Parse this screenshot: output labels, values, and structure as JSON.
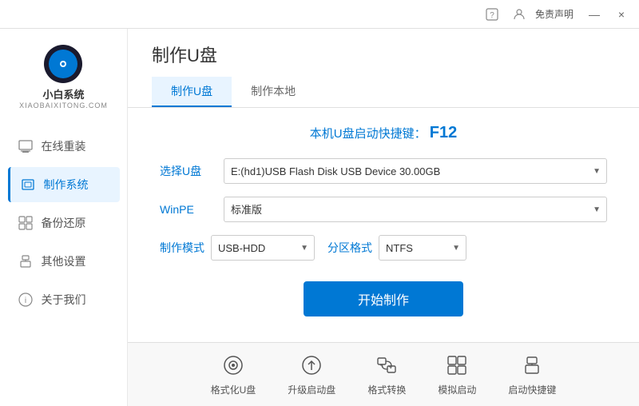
{
  "titlebar": {
    "help_icon": "?",
    "settings_icon": "⚙",
    "free_label": "免责声明",
    "minimize_label": "—",
    "close_label": "×"
  },
  "logo": {
    "text": "小白系统",
    "sub": "XIAOBAIXITONG.COM"
  },
  "nav": {
    "items": [
      {
        "id": "reinstall",
        "label": "在线重装",
        "icon": "🖥"
      },
      {
        "id": "make-system",
        "label": "制作系统",
        "icon": "💾"
      },
      {
        "id": "backup-restore",
        "label": "备份还原",
        "icon": "📋"
      },
      {
        "id": "other-settings",
        "label": "其他设置",
        "icon": "🔒"
      },
      {
        "id": "about",
        "label": "关于我们",
        "icon": "ℹ"
      }
    ]
  },
  "page": {
    "title": "制作U盘",
    "tabs": [
      {
        "id": "make-usb",
        "label": "制作U盘"
      },
      {
        "id": "make-local",
        "label": "制作本地"
      }
    ],
    "active_tab": "make-usb"
  },
  "form": {
    "shortcut_hint": "本机U盘启动快捷键：",
    "shortcut_key": "F12",
    "usb_label": "选择U盘",
    "usb_value": "E:(hd1)USB Flash Disk USB Device 30.00GB",
    "winpe_label": "WinPE",
    "winpe_value": "标准版",
    "mode_label": "制作模式",
    "mode_value": "USB-HDD",
    "partition_label": "分区格式",
    "partition_value": "NTFS",
    "start_btn": "开始制作"
  },
  "toolbar": {
    "items": [
      {
        "id": "format-usb",
        "label": "格式化U盘",
        "icon": "⊙"
      },
      {
        "id": "upgrade-boot",
        "label": "升级启动盘",
        "icon": "⊕"
      },
      {
        "id": "format-convert",
        "label": "格式转换",
        "icon": "⇄"
      },
      {
        "id": "simulate-boot",
        "label": "模拟启动",
        "icon": "⊞"
      },
      {
        "id": "shortcut-key",
        "label": "启动快捷键",
        "icon": "🔒"
      }
    ]
  }
}
